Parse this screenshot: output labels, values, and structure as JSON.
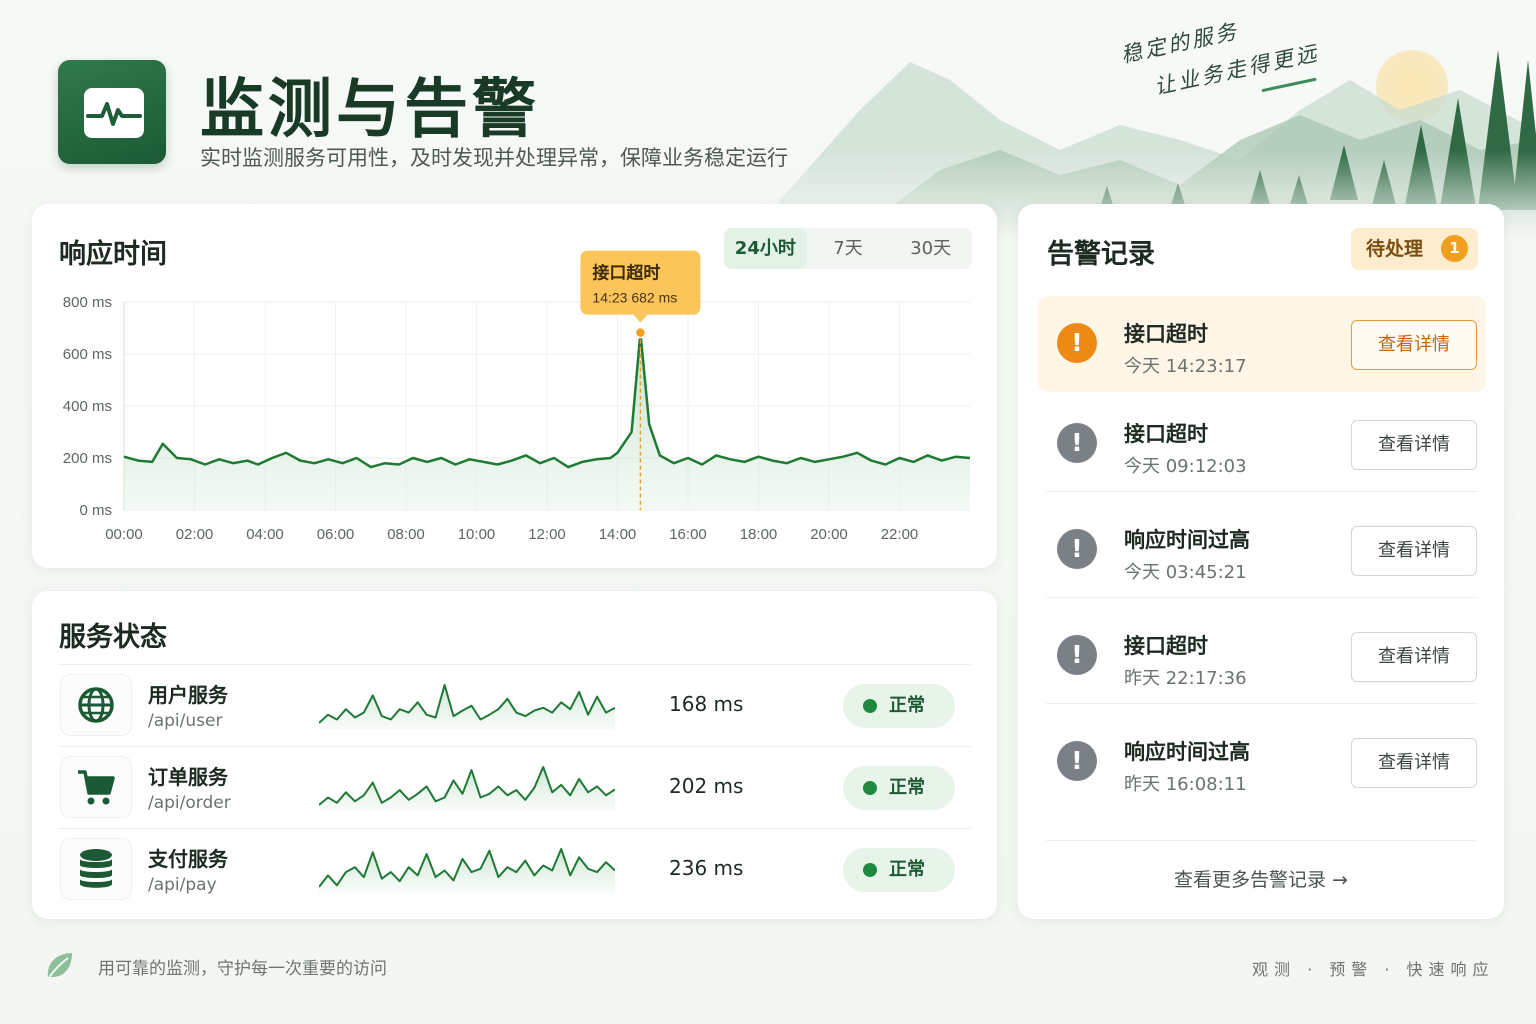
{
  "header": {
    "title": "监测与告警",
    "subtitle": "实时监测服务可用性，及时发现并处理异常，保障业务稳定运行",
    "logo_icon": "pulse-monitor-icon"
  },
  "slogan": {
    "line1": "稳定的服务",
    "line2": "让业务走得更远"
  },
  "response_time": {
    "title": "响应时间",
    "ranges": [
      "24小时",
      "7天",
      "30天"
    ],
    "active_range": "24小时",
    "tooltip": {
      "title": "接口超时",
      "time": "14:23",
      "value": "682 ms"
    }
  },
  "chart_data": {
    "type": "area",
    "title": "响应时间",
    "x_tick_labels": [
      "00:00",
      "02:00",
      "04:00",
      "06:00",
      "08:00",
      "10:00",
      "12:00",
      "14:00",
      "16:00",
      "18:00",
      "20:00",
      "22:00"
    ],
    "y_tick_labels": [
      "0 ms",
      "200 ms",
      "400 ms",
      "600 ms",
      "800 ms"
    ],
    "ylim": [
      0,
      800
    ],
    "xlim_hours": [
      0,
      24
    ],
    "grid": true,
    "series": [
      {
        "x_hours": [
          0,
          0.4,
          0.8,
          1.1,
          1.5,
          1.9,
          2.3,
          2.7,
          3.1,
          3.5,
          3.8,
          4.2,
          4.6,
          5.0,
          5.4,
          5.8,
          6.2,
          6.6,
          7.0,
          7.4,
          7.8,
          8.2,
          8.6,
          9.0,
          9.4,
          9.8,
          10.2,
          10.6,
          11.0,
          11.4,
          11.8,
          12.2,
          12.6,
          13.0,
          13.4,
          13.8,
          14.0,
          14.2,
          14.4,
          14.65,
          14.9,
          15.2,
          15.6,
          16.0,
          16.4,
          16.8,
          17.2,
          17.6,
          18.0,
          18.4,
          18.8,
          19.2,
          19.6,
          20.0,
          20.4,
          20.8,
          21.2,
          21.6,
          22.0,
          22.4,
          22.8,
          23.2,
          23.6,
          24.0
        ],
        "values": [
          205,
          190,
          185,
          255,
          200,
          195,
          175,
          195,
          180,
          190,
          175,
          200,
          220,
          190,
          180,
          195,
          180,
          200,
          165,
          180,
          175,
          200,
          185,
          200,
          175,
          195,
          185,
          175,
          190,
          210,
          180,
          200,
          165,
          185,
          195,
          200,
          220,
          260,
          300,
          682,
          330,
          210,
          180,
          200,
          175,
          210,
          195,
          185,
          205,
          190,
          180,
          200,
          185,
          195,
          205,
          220,
          190,
          175,
          200,
          185,
          210,
          190,
          205,
          200
        ]
      }
    ],
    "annotation": {
      "x_hours": 14.65,
      "value": 682,
      "label": "接口超时",
      "time": "14:23",
      "value_label": "682 ms"
    }
  },
  "services": {
    "title": "服务状态",
    "items": [
      {
        "name": "用户服务",
        "path": "/api/user",
        "ms": "168 ms",
        "status": "正常",
        "icon": "globe-icon",
        "trend": [
          40,
          52,
          45,
          60,
          48,
          55,
          80,
          50,
          45,
          60,
          55,
          70,
          52,
          48,
          95,
          50,
          58,
          65,
          45,
          52,
          60,
          75,
          55,
          50,
          58,
          62,
          55,
          70,
          60,
          85,
          52,
          78,
          55,
          62
        ]
      },
      {
        "name": "订单服务",
        "path": "/api/order",
        "ms": "202 ms",
        "status": "正常",
        "icon": "cart-icon",
        "trend": [
          45,
          55,
          48,
          62,
          50,
          58,
          75,
          48,
          55,
          65,
          52,
          60,
          70,
          50,
          55,
          78,
          60,
          92,
          55,
          60,
          70,
          58,
          65,
          52,
          68,
          96,
          62,
          72,
          58,
          80,
          62,
          70,
          58,
          66
        ]
      },
      {
        "name": "支付服务",
        "path": "/api/pay",
        "ms": "236 ms",
        "status": "正常",
        "icon": "database-icon",
        "trend": [
          48,
          62,
          50,
          66,
          72,
          60,
          90,
          58,
          66,
          55,
          72,
          62,
          88,
          60,
          68,
          56,
          82,
          66,
          70,
          92,
          60,
          72,
          66,
          80,
          62,
          74,
          68,
          94,
          62,
          84,
          70,
          66,
          78,
          68
        ]
      }
    ]
  },
  "alerts": {
    "title": "告警记录",
    "pending_label": "待处理",
    "pending_count": "1",
    "detail_label": "查看详情",
    "items": [
      {
        "title": "接口超时",
        "time": "今天 14:23:17",
        "highlight": true
      },
      {
        "title": "接口超时",
        "time": "今天 09:12:03",
        "highlight": false
      },
      {
        "title": "响应时间过高",
        "time": "今天 03:45:21",
        "highlight": false
      },
      {
        "title": "接口超时",
        "time": "昨天 22:17:36",
        "highlight": false
      },
      {
        "title": "响应时间过高",
        "time": "昨天 16:08:11",
        "highlight": false
      }
    ],
    "more_label": "查看更多告警记录 →"
  },
  "footer": {
    "left_text": "用可靠的监测，守护每一次重要的访问",
    "left_icon": "leaf-icon",
    "right_text": "观测 · 预警 · 快速响应"
  },
  "colors": {
    "brand_green": "#1b5a34",
    "line_green": "#1e7a34",
    "alert_orange": "#ec8a14",
    "tooltip_bg": "#fcc55a",
    "status_dot": "#1f8a3f"
  }
}
